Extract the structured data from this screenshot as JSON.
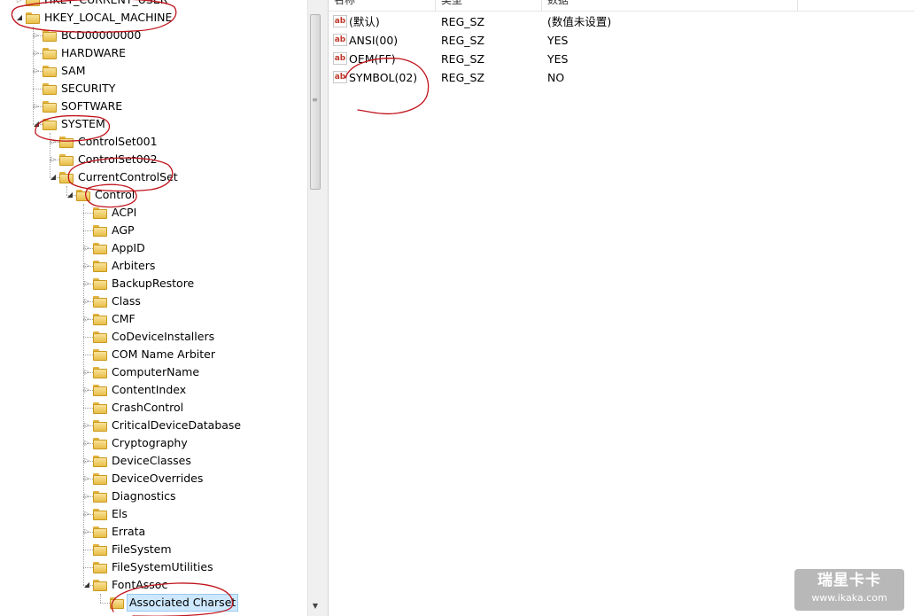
{
  "tree": {
    "items": [
      {
        "label": "HKEY_CURRENT_USER",
        "depth": 0,
        "expander": "collapsed"
      },
      {
        "label": "HKEY_LOCAL_MACHINE",
        "depth": 0,
        "expander": "expanded"
      },
      {
        "label": "BCD00000000",
        "depth": 1,
        "expander": "collapsed"
      },
      {
        "label": "HARDWARE",
        "depth": 1,
        "expander": "collapsed"
      },
      {
        "label": "SAM",
        "depth": 1,
        "expander": "collapsed"
      },
      {
        "label": "SECURITY",
        "depth": 1,
        "expander": "none"
      },
      {
        "label": "SOFTWARE",
        "depth": 1,
        "expander": "collapsed"
      },
      {
        "label": "SYSTEM",
        "depth": 1,
        "expander": "expanded"
      },
      {
        "label": "ControlSet001",
        "depth": 2,
        "expander": "collapsed"
      },
      {
        "label": "ControlSet002",
        "depth": 2,
        "expander": "collapsed"
      },
      {
        "label": "CurrentControlSet",
        "depth": 2,
        "expander": "expanded"
      },
      {
        "label": "Control",
        "depth": 3,
        "expander": "expanded"
      },
      {
        "label": "ACPI",
        "depth": 4,
        "expander": "none"
      },
      {
        "label": "AGP",
        "depth": 4,
        "expander": "none"
      },
      {
        "label": "AppID",
        "depth": 4,
        "expander": "collapsed"
      },
      {
        "label": "Arbiters",
        "depth": 4,
        "expander": "collapsed"
      },
      {
        "label": "BackupRestore",
        "depth": 4,
        "expander": "collapsed"
      },
      {
        "label": "Class",
        "depth": 4,
        "expander": "collapsed"
      },
      {
        "label": "CMF",
        "depth": 4,
        "expander": "collapsed"
      },
      {
        "label": "CoDeviceInstallers",
        "depth": 4,
        "expander": "none"
      },
      {
        "label": "COM Name Arbiter",
        "depth": 4,
        "expander": "none"
      },
      {
        "label": "ComputerName",
        "depth": 4,
        "expander": "collapsed"
      },
      {
        "label": "ContentIndex",
        "depth": 4,
        "expander": "collapsed"
      },
      {
        "label": "CrashControl",
        "depth": 4,
        "expander": "none"
      },
      {
        "label": "CriticalDeviceDatabase",
        "depth": 4,
        "expander": "collapsed"
      },
      {
        "label": "Cryptography",
        "depth": 4,
        "expander": "collapsed"
      },
      {
        "label": "DeviceClasses",
        "depth": 4,
        "expander": "collapsed"
      },
      {
        "label": "DeviceOverrides",
        "depth": 4,
        "expander": "collapsed"
      },
      {
        "label": "Diagnostics",
        "depth": 4,
        "expander": "collapsed"
      },
      {
        "label": "Els",
        "depth": 4,
        "expander": "collapsed"
      },
      {
        "label": "Errata",
        "depth": 4,
        "expander": "collapsed"
      },
      {
        "label": "FileSystem",
        "depth": 4,
        "expander": "none"
      },
      {
        "label": "FileSystemUtilities",
        "depth": 4,
        "expander": "none"
      },
      {
        "label": "FontAssoc",
        "depth": 4,
        "expander": "expanded"
      },
      {
        "label": "Associated Charset",
        "depth": 5,
        "expander": "none",
        "selected": true
      }
    ]
  },
  "list": {
    "columns": {
      "name": "名称",
      "type": "类型",
      "data": "数据"
    },
    "rows": [
      {
        "name": "(默认)",
        "type": "REG_SZ",
        "data": "(数值未设置)"
      },
      {
        "name": "ANSI(00)",
        "type": "REG_SZ",
        "data": "YES"
      },
      {
        "name": "OEM(FF)",
        "type": "REG_SZ",
        "data": "YES"
      },
      {
        "name": "SYMBOL(02)",
        "type": "REG_SZ",
        "data": "NO"
      }
    ],
    "value_icon_glyph": "ab"
  },
  "icons": {
    "folder": "folder-icon",
    "value": "string-value-icon",
    "expand": "expand-triangle-icon",
    "collapse": "collapse-triangle-icon"
  },
  "colors": {
    "selection_bg": "#cde8ff",
    "annotation_ink": "#c0141c",
    "folder_yellow": "#e8be48"
  },
  "watermark": {
    "title": "瑞星卡卡",
    "url": "www.ikaka.com"
  }
}
